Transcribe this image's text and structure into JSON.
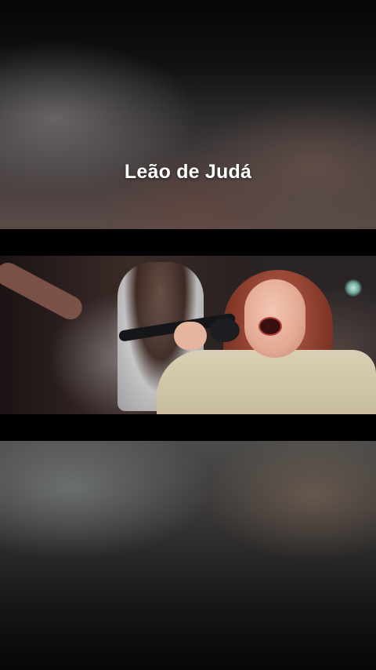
{
  "overlay": {
    "title": "Leão de Judá"
  },
  "colors": {
    "background": "#0b0b0c",
    "title_text": "#ffffff",
    "letterbox": "#000000"
  }
}
